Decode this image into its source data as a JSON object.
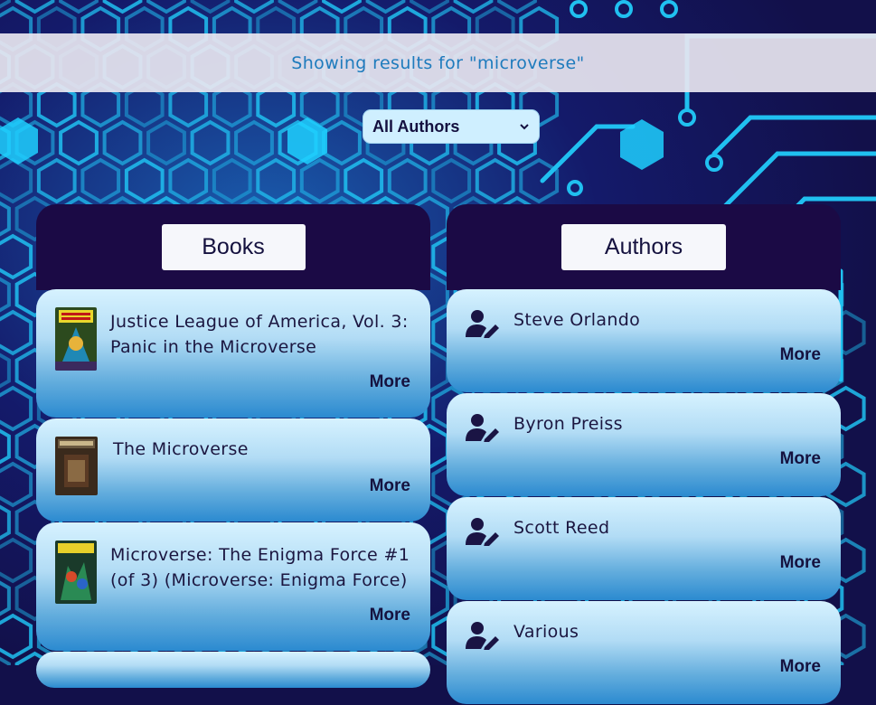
{
  "banner": {
    "text": "Showing results for \"microverse\""
  },
  "filter": {
    "selected": "All Authors"
  },
  "books": {
    "header": "Books",
    "items": [
      {
        "title_line1": "Justice League of America, Vol. 3:",
        "title_line2": "Panic in the Microverse",
        "more": "More",
        "cover_icon": "book-cover-thumbnail"
      },
      {
        "title_line1": "The Microverse",
        "title_line2": "",
        "more": "More",
        "cover_icon": "book-cover-thumbnail"
      },
      {
        "title_line1": "Microverse: The Enigma Force #1",
        "title_line2": "(of 3) (Microverse: Enigma Force)",
        "more": "More",
        "cover_icon": "book-cover-thumbnail"
      }
    ]
  },
  "authors": {
    "header": "Authors",
    "items": [
      {
        "name": "Steve Orlando",
        "more": "More",
        "icon": "user-pen-icon"
      },
      {
        "name": "Byron Preiss",
        "more": "More",
        "icon": "user-pen-icon"
      },
      {
        "name": "Scott Reed",
        "more": "More",
        "icon": "user-pen-icon"
      },
      {
        "name": "Various",
        "more": "More",
        "icon": "user-pen-icon"
      }
    ]
  },
  "colors": {
    "background": "#12104a",
    "circuit": "#1fb8ea",
    "header_panel": "#1b0a45",
    "banner_text": "#1e7bbd",
    "text_dark": "#15123f"
  }
}
